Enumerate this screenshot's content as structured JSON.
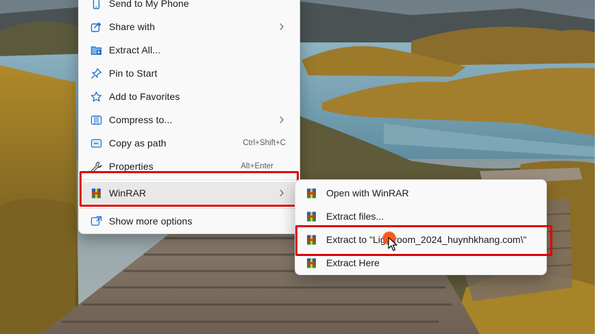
{
  "main_menu": {
    "items": [
      {
        "label": "Send to My Phone",
        "icon": "phone-icon",
        "shortcut": "",
        "submenu": false
      },
      {
        "label": "Share with",
        "icon": "share-icon",
        "shortcut": "",
        "submenu": true
      },
      {
        "label": "Extract All...",
        "icon": "extract-all-icon",
        "shortcut": "",
        "submenu": false
      },
      {
        "label": "Pin to Start",
        "icon": "pin-icon",
        "shortcut": "",
        "submenu": false
      },
      {
        "label": "Add to Favorites",
        "icon": "star-icon",
        "shortcut": "",
        "submenu": false
      },
      {
        "label": "Compress to...",
        "icon": "compress-icon",
        "shortcut": "",
        "submenu": true
      },
      {
        "label": "Copy as path",
        "icon": "copy-path-icon",
        "shortcut": "Ctrl+Shift+C",
        "submenu": false
      },
      {
        "label": "Properties",
        "icon": "wrench-icon",
        "shortcut": "Alt+Enter",
        "submenu": false
      },
      {
        "label": "WinRAR",
        "icon": "winrar-icon",
        "shortcut": "",
        "submenu": true
      },
      {
        "label": "Show more options",
        "icon": "show-more-icon",
        "shortcut": "",
        "submenu": false
      }
    ]
  },
  "submenu": {
    "items": [
      {
        "label": "Open with WinRAR",
        "icon": "winrar-icon"
      },
      {
        "label": "Extract files...",
        "icon": "winrar-icon"
      },
      {
        "label": "Extract to \"Lightroom_2024_huynhkhang.com\\\"",
        "icon": "winrar-icon"
      },
      {
        "label": "Extract Here",
        "icon": "winrar-icon"
      }
    ]
  },
  "colors": {
    "highlight_box": "#e00000",
    "menu_background": "#f9f9f9",
    "accent_icon": "#1a6fd1",
    "cursor_dot": "#f2541a"
  }
}
